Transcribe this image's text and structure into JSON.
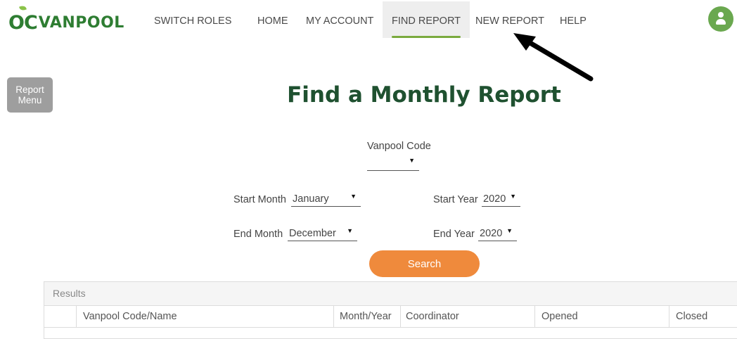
{
  "brand": {
    "logo_oc": "OC",
    "logo_van": "VANPOOL"
  },
  "nav": {
    "switch_roles": "SWITCH ROLES",
    "home": "HOME",
    "my_account": "MY ACCOUNT",
    "find_report": "FIND REPORT",
    "new_report": "NEW REPORT",
    "help": "HELP"
  },
  "sidebar": {
    "report_menu_line1": "Report",
    "report_menu_line2": "Menu"
  },
  "page": {
    "title": "Find a Monthly Report"
  },
  "form": {
    "vanpool_code_label": "Vanpool Code",
    "vanpool_code_value": "",
    "start_month_label": "Start Month",
    "start_month_value": "January",
    "start_year_label": "Start Year",
    "start_year_value": "2020",
    "end_month_label": "End Month",
    "end_month_value": "December",
    "end_year_label": "End Year",
    "end_year_value": "2020",
    "search_label": "Search"
  },
  "results": {
    "title": "Results",
    "columns": [
      "Vanpool Code/Name",
      "Month/Year",
      "Coordinator",
      "Opened",
      "Closed"
    ]
  },
  "colors": {
    "brand_green": "#2e7d32",
    "title_green": "#1f5130",
    "accent_orange": "#ef8a3c",
    "menu_gray": "#9e9e9e"
  }
}
